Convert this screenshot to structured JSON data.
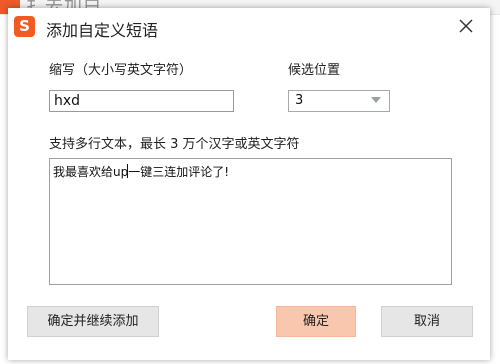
{
  "background": {
    "text_fragment": "扌去加白"
  },
  "dialog": {
    "logo_glyph": "S",
    "title": "添加自定义短语",
    "close_icon": "close-icon"
  },
  "form": {
    "abbr_label": "缩写（大小写英文字符）",
    "abbr_value": "hxd",
    "position_label": "候选位置",
    "position_value": "3",
    "content_label": "支持多行文本，最长 3 万个汉字或英文字符",
    "content_before_caret": "我最喜欢给up",
    "content_after_caret": "一键三连加评论了!"
  },
  "buttons": {
    "confirm_and_add": "确定并继续添加",
    "confirm": "确定",
    "cancel": "取消"
  },
  "colors": {
    "brand": "#f15a22",
    "confirm_bg": "#f9c7ae",
    "neutral_btn_bg": "#e6e6e6"
  }
}
